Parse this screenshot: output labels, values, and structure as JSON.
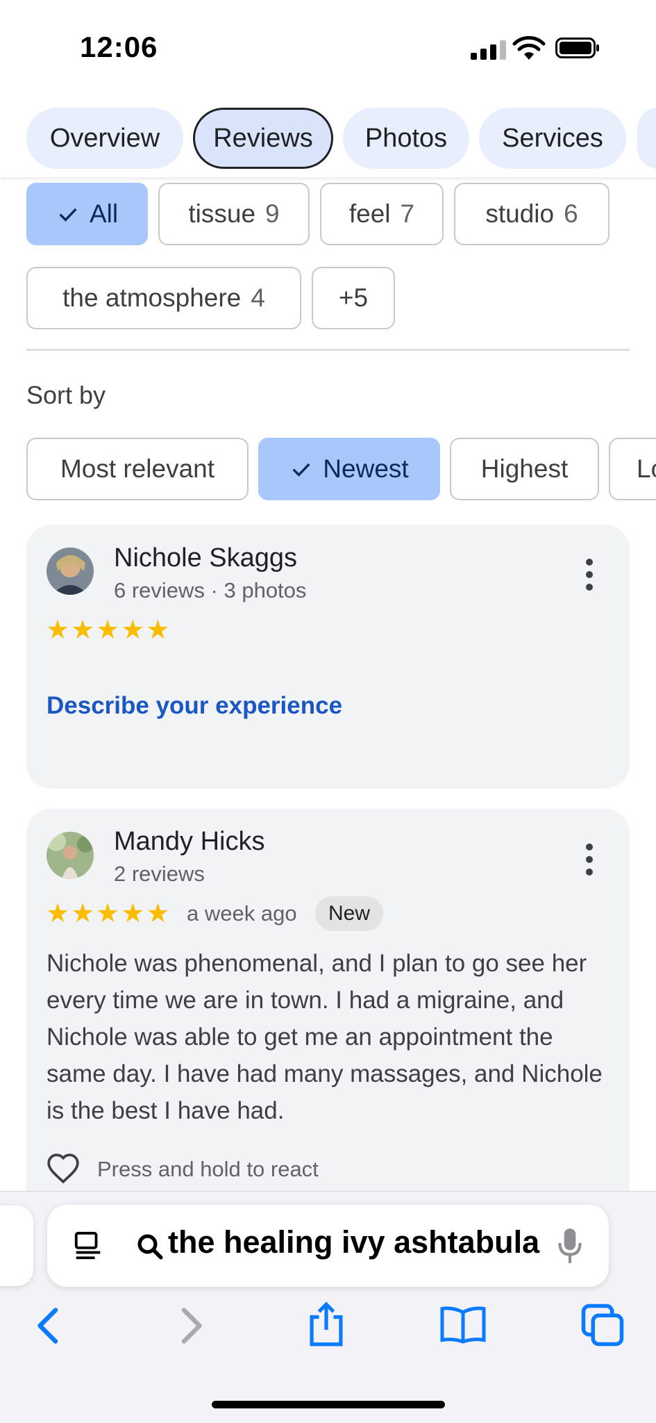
{
  "status": {
    "time": "12:06"
  },
  "tabs": [
    {
      "label": "Overview",
      "active": false
    },
    {
      "label": "Reviews",
      "active": true
    },
    {
      "label": "Photos",
      "active": false
    },
    {
      "label": "Services",
      "active": false
    }
  ],
  "topics": [
    {
      "label": "All",
      "count": "",
      "selected": true
    },
    {
      "label": "tissue",
      "count": "9",
      "selected": false
    },
    {
      "label": "feel",
      "count": "7",
      "selected": false
    },
    {
      "label": "studio",
      "count": "6",
      "selected": false
    },
    {
      "label": "the atmosphere",
      "count": "4",
      "selected": false
    },
    {
      "label": "+5",
      "count": "",
      "selected": false
    }
  ],
  "sort": {
    "label": "Sort by",
    "options": [
      {
        "label": "Most relevant",
        "selected": false
      },
      {
        "label": "Newest",
        "selected": true
      },
      {
        "label": "Highest",
        "selected": false
      },
      {
        "label": "Lo",
        "selected": false
      }
    ]
  },
  "reviews": [
    {
      "name": "Nichole Skaggs",
      "meta": "6 reviews · 3 photos",
      "rating": 5,
      "prompt": "Describe your experience"
    },
    {
      "name": "Mandy Hicks",
      "meta": "2 reviews",
      "rating": 5,
      "when": "a week ago",
      "badge": "New",
      "text": "Nichole was phenomenal, and I plan to go see her every time we are in town. I had a migraine, and Nichole was able to get me an appointment the same day. I have had many massages, and Nichole is the best I have had.",
      "react_hint": "Press and hold to react"
    }
  ],
  "browser": {
    "address": "the healing ivy ashtabula",
    "icons": [
      "reader-icon",
      "search-icon",
      "microphone-icon",
      "back-icon",
      "forward-icon",
      "share-icon",
      "bookmarks-icon",
      "tabs-icon"
    ]
  },
  "colors": {
    "accent_selected": "#a8c7fa",
    "tab_bg": "#e8eefc",
    "star": "#fbbc04",
    "link": "#1a56c4",
    "ios_blue": "#0a7aff"
  }
}
